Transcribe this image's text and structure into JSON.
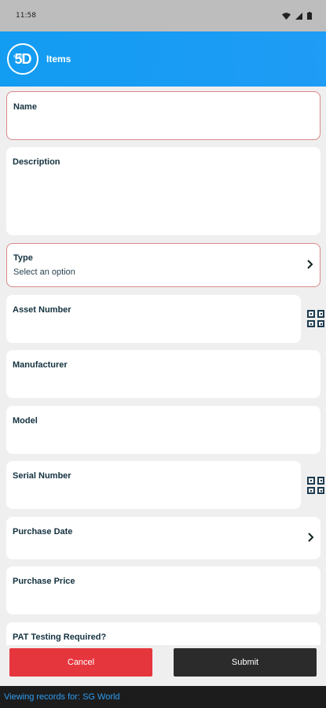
{
  "status_bar": {
    "time": "11:58"
  },
  "app_bar": {
    "title": "Items",
    "logo_text": "5D",
    "logo_small": "smart"
  },
  "form": {
    "name_label": "Name",
    "description_label": "Description",
    "type_label": "Type",
    "type_placeholder": "Select an option",
    "asset_number_label": "Asset Number",
    "manufacturer_label": "Manufacturer",
    "model_label": "Model",
    "serial_number_label": "Serial Number",
    "purchase_date_label": "Purchase Date",
    "purchase_price_label": "Purchase Price",
    "pat_label": "PAT Testing Required?"
  },
  "actions": {
    "cancel_label": "Cancel",
    "submit_label": "Submit"
  },
  "footer": {
    "text": "Viewing records for: SG World"
  },
  "colors": {
    "app_bar": "#1f9cf5",
    "error_border": "#d9898a",
    "cancel": "#e6363d",
    "submit": "#2b2b2b",
    "footer_text": "#2f9df2"
  },
  "icons": {
    "wifi": "wifi-icon",
    "signal": "signal-icon",
    "battery": "battery-icon",
    "chevron": "chevron-right-icon",
    "qr": "qr-scan-icon"
  }
}
